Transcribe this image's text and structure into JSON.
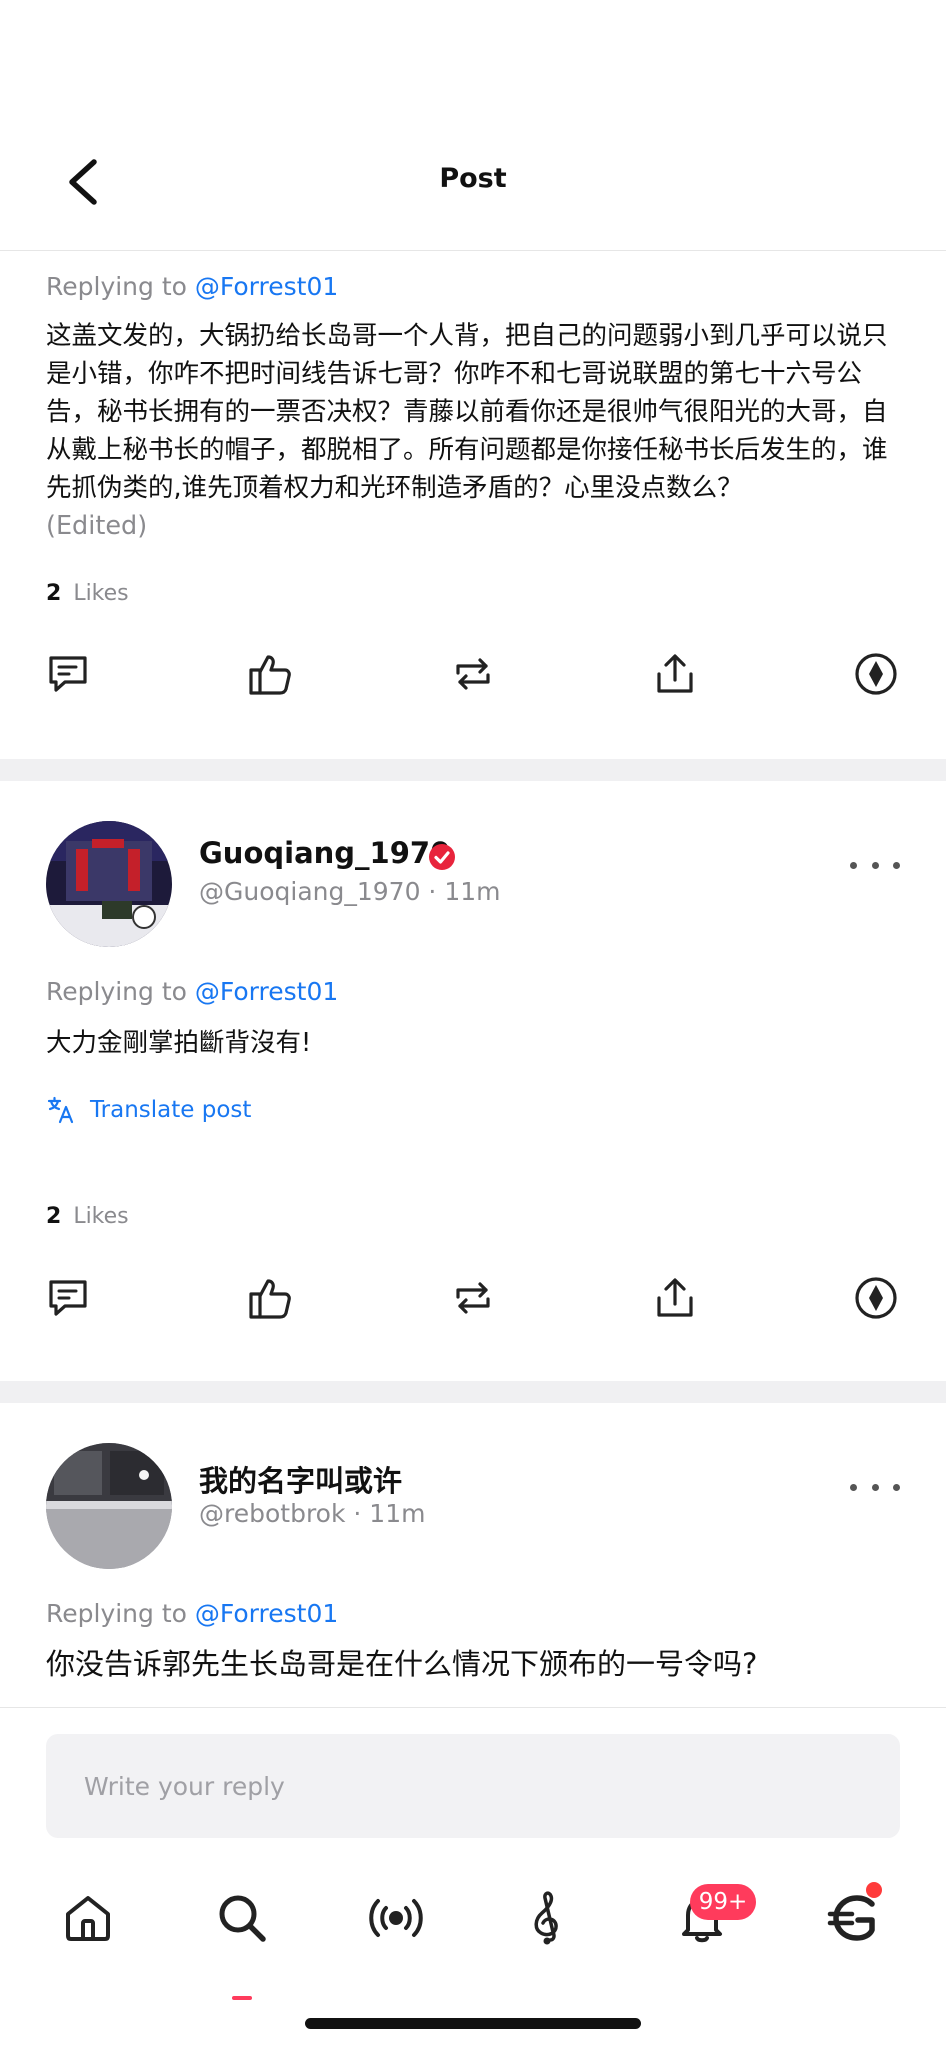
{
  "header": {
    "title": "Post"
  },
  "posts": [
    {
      "replying_label": "Replying to ",
      "replying_handle": "@Forrest01",
      "text": "这盖文发的，大锅扔给长岛哥一个人背，把自己的问题弱小到几乎可以说只是小错，你咋不把时间线告诉七哥？你咋不和七哥说联盟的第七十六号公告，秘书长拥有的一票否决权？青藤以前看你还是很帅气很阳光的大哥，自从戴上秘书长的帽子，都脱相了。所有问题都是你接任秘书长后发生的，谁先抓伪类的,谁先顶着权力和光环制造矛盾的？心里没点数么？",
      "edited": "(Edited)",
      "likes_count": "2",
      "likes_label": "Likes"
    },
    {
      "author_name": "Guoqiang_1970",
      "author_meta": "@Guoqiang_1970 · 11m",
      "replying_label": "Replying to ",
      "replying_handle": "@Forrest01",
      "text": "大力金剛掌拍斷背沒有!",
      "translate_label": "Translate post",
      "likes_count": "2",
      "likes_label": "Likes"
    },
    {
      "author_name": "我的名字叫或许",
      "author_meta": "@rebotbrok · 11m",
      "replying_label": "Replying to ",
      "replying_handle": "@Forrest01",
      "text": "你没告诉郭先生长岛哥是在什么情况下颁布的一号令吗?"
    }
  ],
  "reply": {
    "placeholder": "Write your reply"
  },
  "notifications": {
    "badge": "99+"
  },
  "colors": {
    "accent": "#1877f2",
    "badge": "#ff3b5c",
    "verified": "#e8243c"
  }
}
